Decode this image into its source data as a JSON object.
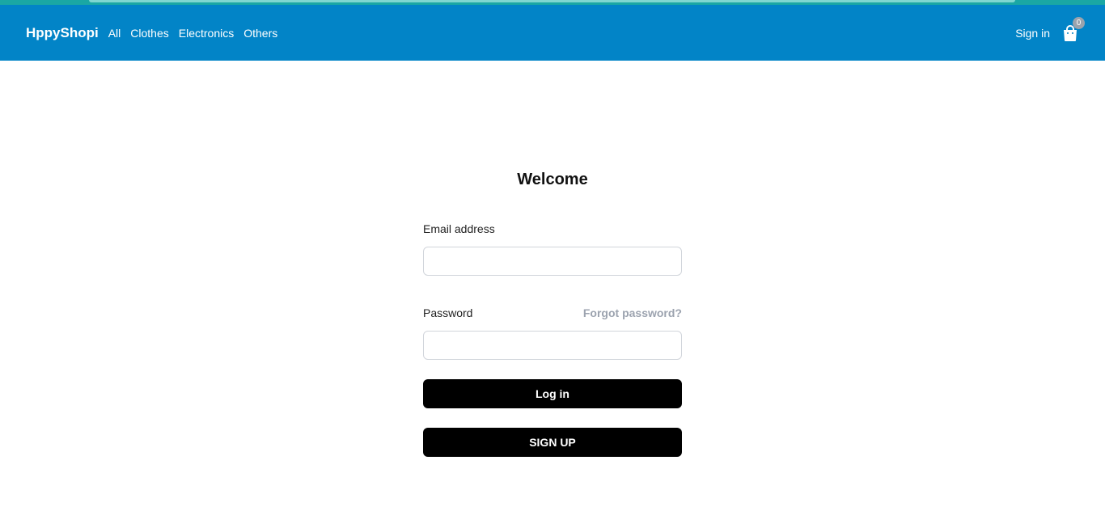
{
  "navbar": {
    "brand": "HppyShopi",
    "links": [
      "All",
      "Clothes",
      "Electronics",
      "Others"
    ],
    "signin": "Sign in",
    "cart_count": "0",
    "cart_icon": "shopping-bag-icon",
    "bg_color": "#0284c7"
  },
  "login": {
    "title": "Welcome",
    "email_label": "Email address",
    "email_value": "",
    "password_label": "Password",
    "password_value": "",
    "forgot_label": "Forgot password?",
    "login_button": "Log in",
    "signup_button": "SIGN UP"
  }
}
